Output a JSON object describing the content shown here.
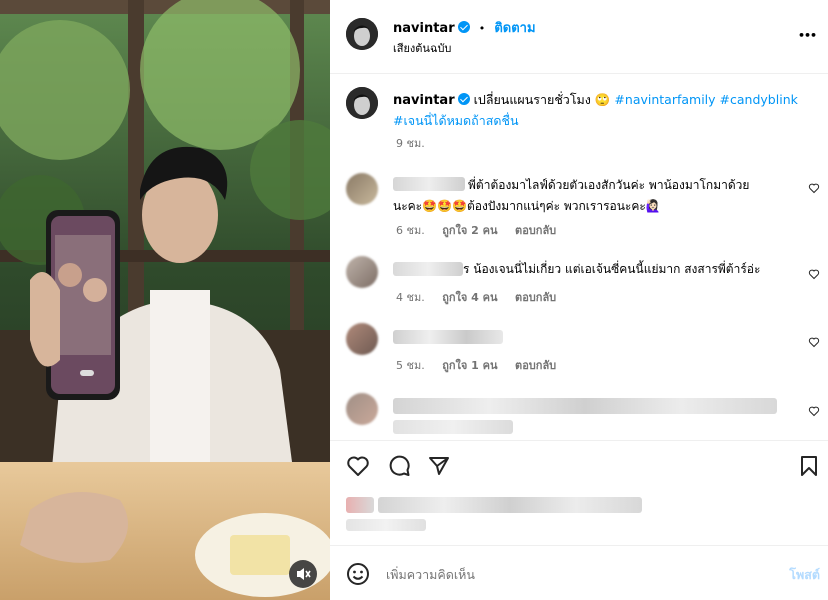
{
  "post": {
    "username": "navintar",
    "follow_label": "ติดตาม",
    "dot": "•",
    "audio": "เสียงต้นฉบับ",
    "more_label": "•••"
  },
  "caption": {
    "username": "navintar",
    "text": "เปลี่ยนแผนรายชั่วโมง 🙄",
    "tag1": "#navintarfamily",
    "tag2": "#candyblink",
    "tag3": "#เจนนี่ได้หมดถ้าสดชื่น",
    "time": "9 ชม."
  },
  "comments": [
    {
      "text_line1": "พี่ต้าต้องมาไลฟ์ด้วยตัวเองสักวันค่ะ พาน้องมาโกมาด้วย",
      "text_line2": "นะคะ🤩🤩🤩ต้องปังมากแน่ๆค่ะ พวกเรารอนะคะ🙋🏻‍♀️",
      "time": "6 ชม.",
      "likes": "ถูกใจ 2 คน",
      "reply": "ตอบกลับ"
    },
    {
      "text_line1": "ร น้องเจนนี่ไม่เกี่ยว แต่เอเจ้นซี่คนนี้แย่มาก สงสารพี่ต้าร์อ่ะ",
      "time": "4 ชม.",
      "likes": "ถูกใจ 4 คน",
      "reply": "ตอบกลับ"
    },
    {
      "time": "5 ชม.",
      "likes": "ถูกใจ 1 คน",
      "reply": "ตอบกลับ"
    }
  ],
  "composer": {
    "placeholder": "เพิ่มความคิดเห็น",
    "post_label": "โพสต์"
  },
  "colors": {
    "accent": "#0095f6",
    "muted": "#737373",
    "post_button_disabled": "#b3dbff"
  }
}
